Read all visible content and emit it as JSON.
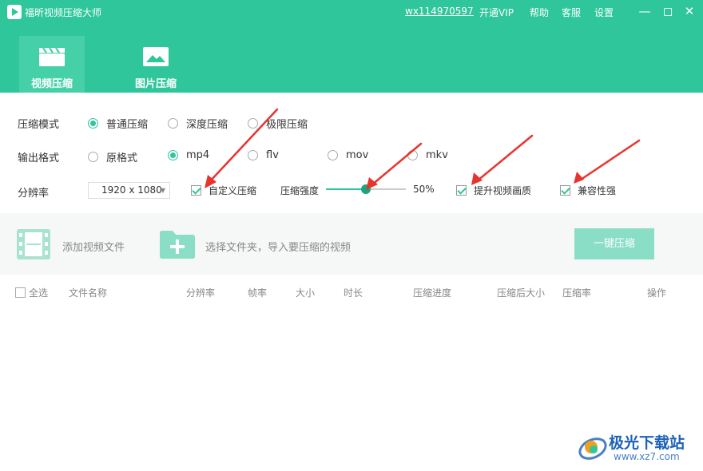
{
  "app": {
    "title": "福昕视频压缩大师",
    "account": "wx114970597",
    "vip_label": "开通VIP",
    "help_label": "帮助",
    "service_label": "客服",
    "settings_label": "设置"
  },
  "window_controls": {
    "minimize": "—",
    "restore": "◻",
    "close": "✕"
  },
  "tabs": [
    {
      "label": "视频压缩",
      "icon": "clapperboard-icon",
      "active": true
    },
    {
      "label": "图片压缩",
      "icon": "image-icon",
      "active": false
    }
  ],
  "settings": {
    "mode": {
      "label": "压缩模式",
      "options": [
        "普通压缩",
        "深度压缩",
        "极限压缩"
      ],
      "selected": "普通压缩"
    },
    "format": {
      "label": "输出格式",
      "options": [
        "原格式",
        "mp4",
        "flv",
        "mov",
        "mkv"
      ],
      "selected": "mp4"
    },
    "resolution": {
      "label": "分辨率",
      "value": "1920 x 1080"
    },
    "custom_compress": {
      "label": "自定义压缩",
      "checked": true
    },
    "strength": {
      "label": "压缩强度",
      "value_text": "50%",
      "value": 0.5
    },
    "enhance_quality": {
      "label": "提升视频画质",
      "checked": true
    },
    "compatibility": {
      "label": "兼容性强",
      "checked": true
    }
  },
  "toolbar": {
    "add_file_label": "添加视频文件",
    "choose_folder_label": "选择文件夹，导入要压缩的视频",
    "compress_button": "一键压缩"
  },
  "table": {
    "select_all": "全选",
    "columns": [
      "文件名称",
      "分辨率",
      "帧率",
      "大小",
      "时长",
      "压缩进度",
      "压缩后大小",
      "压缩率",
      "操作"
    ]
  },
  "watermark": {
    "name": "极光下载站",
    "url": "www.xz7.com"
  },
  "colors": {
    "brand": "#2ec69a",
    "annotation": "#e8342e"
  }
}
